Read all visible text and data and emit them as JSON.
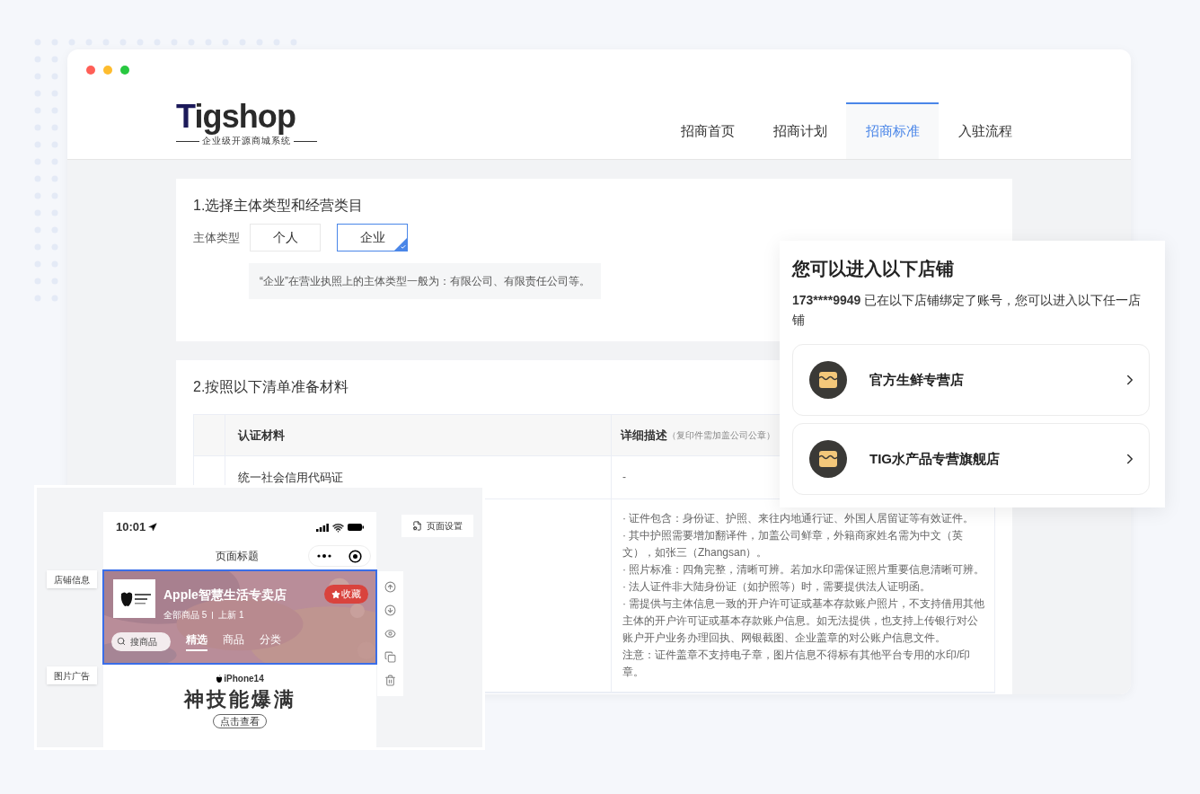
{
  "window": {
    "controls": [
      {
        "color": "#ff5f57"
      },
      {
        "color": "#febc2e"
      },
      {
        "color": "#28c840"
      }
    ]
  },
  "header": {
    "logo": {
      "wordmark": "Tigshop",
      "tagline": "企业级开源商城系统"
    },
    "tabs": [
      {
        "label": "招商首页",
        "selected": false
      },
      {
        "label": "招商计划",
        "selected": false
      },
      {
        "label": "招商标准",
        "selected": true
      },
      {
        "label": "入驻流程",
        "selected": false
      }
    ]
  },
  "section1": {
    "title": "1.选择主体类型和经营类目",
    "field_label": "主体类型",
    "options": [
      {
        "label": "个人",
        "selected": false
      },
      {
        "label": "企业",
        "selected": true
      }
    ],
    "hint": "“企业”在营业执照上的主体类型一般为：有限公司、有限责任公司等。"
  },
  "section2": {
    "title": "2.按照以下清单准备材料",
    "table": {
      "columns": [
        {
          "label": "认证材料"
        },
        {
          "label": "详细描述",
          "note": "（复印件需加盖公司公章）"
        }
      ],
      "rows": [
        {
          "material": "统一社会信用代码证",
          "description": [
            "-"
          ]
        },
        {
          "description": [
            "· 证件包含：身份证、护照、来往内地通行证、外国人居留证等有效证件。",
            "· 其中护照需要增加翻译件，加盖公司鲜章，外籍商家姓名需为中文（英文），如张三（Zhangsan）。",
            "· 照片标准：四角完整，清晰可辨。若加水印需保证照片重要信息清晰可辨。",
            "· 法人证件非大陆身份证（如护照等）时，需要提供法人证明函。",
            "· 需提供与主体信息一致的开户许可证或基本存款账户照片，不支持借用其他主体的开户许可证或基本存款账户信息。如无法提供，也支持上传银行对公账户开户业务办理回执、网银截图、企业盖章的对公账户信息文件。",
            "注意：证件盖章不支持电子章，图片信息不得标有其他平台专用的水印/印章。"
          ]
        }
      ]
    }
  },
  "store_popup": {
    "title": "您可以进入以下店铺",
    "account": "173****9949",
    "message": "已在以下店铺绑定了账号，您可以进入以下任一店铺",
    "stores": [
      {
        "name": "官方生鲜专营店"
      },
      {
        "name": "TIG水产品专营旗舰店"
      }
    ]
  },
  "editor": {
    "status_time": "10:01",
    "page_title": "页面标题",
    "page_settings": "页面设置",
    "side_labels": [
      "店铺信息",
      "图片广告"
    ],
    "store": {
      "name": "Apple智慧生活专卖店",
      "favorite": "收藏",
      "stats": [
        "全部商品 5",
        "上新 1"
      ],
      "search_placeholder": "搜商品",
      "tabs": [
        {
          "label": "精选",
          "selected": true
        },
        {
          "label": "商品",
          "selected": false
        },
        {
          "label": "分类",
          "selected": false
        }
      ]
    },
    "ad": {
      "brand": "iPhone14",
      "headline": "神技能爆满",
      "button": "点击查看"
    }
  }
}
